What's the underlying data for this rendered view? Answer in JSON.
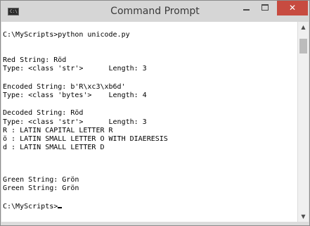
{
  "window": {
    "title": "Command Prompt",
    "icon_name": "console-icon",
    "icon_glyph": "C:\\",
    "close_glyph": "✕"
  },
  "console": {
    "lines": [
      "C:\\MyScripts>python unicode.py",
      "",
      "Red String: Röd",
      "Type: <class 'str'>      Length: 3",
      "",
      "Encoded String: b'R\\xc3\\xb6d'",
      "Type: <class 'bytes'>    Length: 4",
      "",
      "Decoded String: Röd",
      "Type: <class 'str'>      Length: 3",
      "R : LATIN CAPITAL LETTER R",
      "ö : LATIN SMALL LETTER O WITH DIAERESIS",
      "d : LATIN SMALL LETTER D",
      "",
      "Green String: Grön",
      "Green String: Grön",
      "",
      "C:\\MyScripts>"
    ]
  },
  "colors": {
    "close_button": "#c74b40",
    "titlebar": "#d6d6d6",
    "console_bg": "#ffffff",
    "console_text": "#000000"
  }
}
